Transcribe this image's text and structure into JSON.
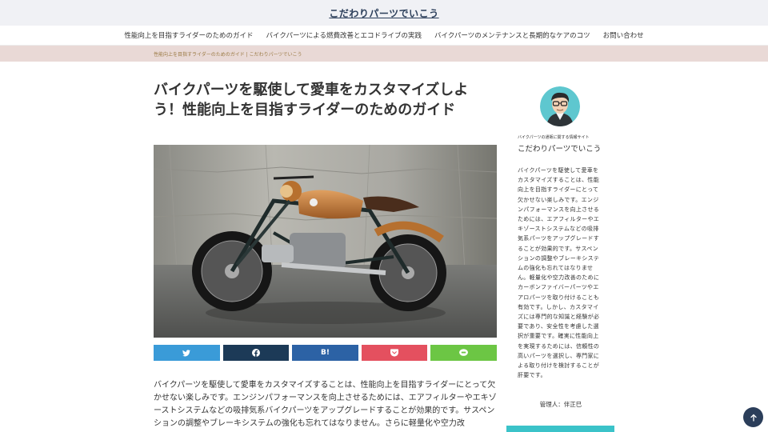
{
  "header": {
    "site_title": "こだわりパーツでいこう"
  },
  "nav": {
    "items": [
      "性能向上を目指すライダーのためのガイド",
      "バイクパーツによる燃費改善とエコドライブの実践",
      "バイクパーツのメンテナンスと長期的なケアのコツ",
      "お問い合わせ"
    ]
  },
  "breadcrumb": "性能向上を目指すライダーのためのガイド | こだわりパーツでいこう",
  "article": {
    "title": "バイクパーツを駆使して愛車をカスタマイズしよう！性能向上を目指すライダーのためのガイド",
    "hero_image": "motorcycle-photo",
    "share": [
      {
        "label": "",
        "icon": "twitter-icon",
        "color": "#3a9bd8"
      },
      {
        "label": "",
        "icon": "facebook-icon",
        "color": "#1c3a57"
      },
      {
        "label": "B!",
        "icon": "hatena-icon",
        "color": "#2c62a5"
      },
      {
        "label": "",
        "icon": "pocket-icon",
        "color": "#e4505f"
      },
      {
        "label": "",
        "icon": "line-icon",
        "color": "#6cc644"
      }
    ],
    "body": "バイクパーツを駆使して愛車をカスタマイズすることは、性能向上を目指すライダーにとって欠かせない楽しみです。エンジンパフォーマンスを向上させるためには、エアフィルターやエキゾーストシステムなどの吸排気系バイクパーツをアップグレードすることが効果的です。サスペンションの調整やブレーキシステムの強化も忘れてはなりません。さらに軽量化や空力改"
  },
  "sidebar": {
    "caption": "バイクパーツの通販に関する情報サイト",
    "site_name": "こだわりパーツでいこう",
    "description": "バイクパーツを駆使して愛車をカスタマイズすることは、性能向上を目指すライダーにとって欠かせない楽しみです。エンジンパフォーマンスを向上させるためには、エアフィルターやエキゾーストシステムなどの吸排気系パーツをアップグレードすることが効果的です。サスペンションの調整やブレーキシステムの強化も忘れてはなりません。軽量化や空力改善のためにカーボンファイバーパーツやエアロパーツを取り付けることも有効です。しかし、カスタマイズには専門的な知識と経験が必要であり、安全性を考慮した選択が重要です。確実に性能向上を実現するためには、信頼性の高いパーツを選択し、専門家による取り付けを検討することが肝要です。",
    "admin": "管理人：伴正巳"
  }
}
